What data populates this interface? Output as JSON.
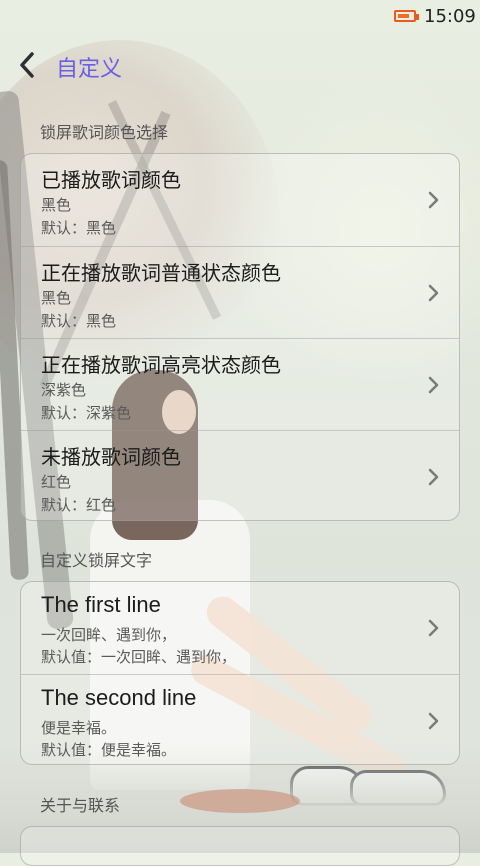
{
  "status": {
    "time": "15:09",
    "battery_percent": 80
  },
  "header": {
    "title": "自定义"
  },
  "sections": [
    {
      "header": "锁屏歌词颜色选择",
      "items": [
        {
          "title": "已播放歌词颜色",
          "value": "黑色",
          "default": "默认：黑色"
        },
        {
          "title": "正在播放歌词普通状态颜色",
          "value": "黑色",
          "default": "默认：黑色"
        },
        {
          "title": "正在播放歌词高亮状态颜色",
          "value": "深紫色",
          "default": "默认：深紫色"
        },
        {
          "title": "未播放歌词颜色",
          "value": "红色",
          "default": "默认：红色"
        }
      ]
    },
    {
      "header": "自定义锁屏文字",
      "items": [
        {
          "title": "The first line",
          "value": "一次回眸、遇到你，",
          "default": "默认值：一次回眸、遇到你，"
        },
        {
          "title": "The second line",
          "value": "便是幸福。",
          "default": "默认值：便是幸福。"
        }
      ]
    },
    {
      "header": "关于与联系"
    }
  ],
  "colors": {
    "accent": "#6a5de6",
    "battery": "#f06a2a"
  },
  "icons": {
    "back": "back-arrow-icon",
    "chevron": "chevron-right-icon",
    "battery": "battery-icon"
  }
}
